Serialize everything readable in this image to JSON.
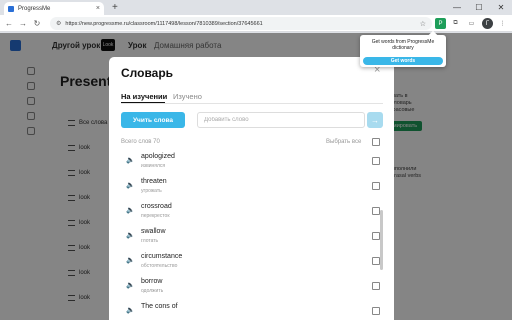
{
  "browser": {
    "tab_title": "ProgressMe",
    "tab_close": "×",
    "new_tab": "+",
    "url": "https://new.progressme.ru/classroom/1117498/lesson/7810389/section/37645661",
    "back": "←",
    "forward": "→",
    "reload": "↻",
    "star": "☆",
    "minimize": "—",
    "maximize": "☐",
    "close": "✕",
    "profile_letter": "Г",
    "ext_letter": "P",
    "puzzle": "⧉",
    "menu": "⋮"
  },
  "app": {
    "nav_prev": "Другой урок",
    "nav_look": "Look",
    "nav_lesson": "Урок",
    "nav_homework": "Домашняя работа",
    "bg_title": "Presentin",
    "bg_rows": [
      "Все слова",
      "look",
      "look",
      "look",
      "look",
      "look",
      "look",
      "look"
    ],
    "right_text_1": "ывать в",
    "right_text_2": "ссловарь",
    "right_text_3": "фрасовые",
    "right_text_4": "выполнили",
    "right_text_5": "phrasal verbs",
    "right_button": "мировать"
  },
  "modal": {
    "title": "Словарь",
    "close": "×",
    "tab_learning": "На изучении",
    "tab_learned": "Изучено",
    "learn_button": "Учить слова",
    "add_placeholder": "Добавить слово",
    "add_arrow": "→",
    "total_words": "Всего слов 70",
    "select_all": "Выбрать все",
    "words": [
      {
        "en": "apologized",
        "ru": "извинялся"
      },
      {
        "en": "threaten",
        "ru": "угрожать"
      },
      {
        "en": "crossroad",
        "ru": "перекресток"
      },
      {
        "en": "swallow",
        "ru": "глотать"
      },
      {
        "en": "circumstance",
        "ru": "обстоятельство"
      },
      {
        "en": "borrow",
        "ru": "одолжить"
      },
      {
        "en": "The cons of",
        "ru": ""
      }
    ]
  },
  "popup": {
    "text": "Get words from ProgressMe dictionary",
    "button": "Get words"
  },
  "icons": {
    "speaker": "🔈",
    "favicon": "progressme-icon",
    "logo": "progressme-logo"
  }
}
